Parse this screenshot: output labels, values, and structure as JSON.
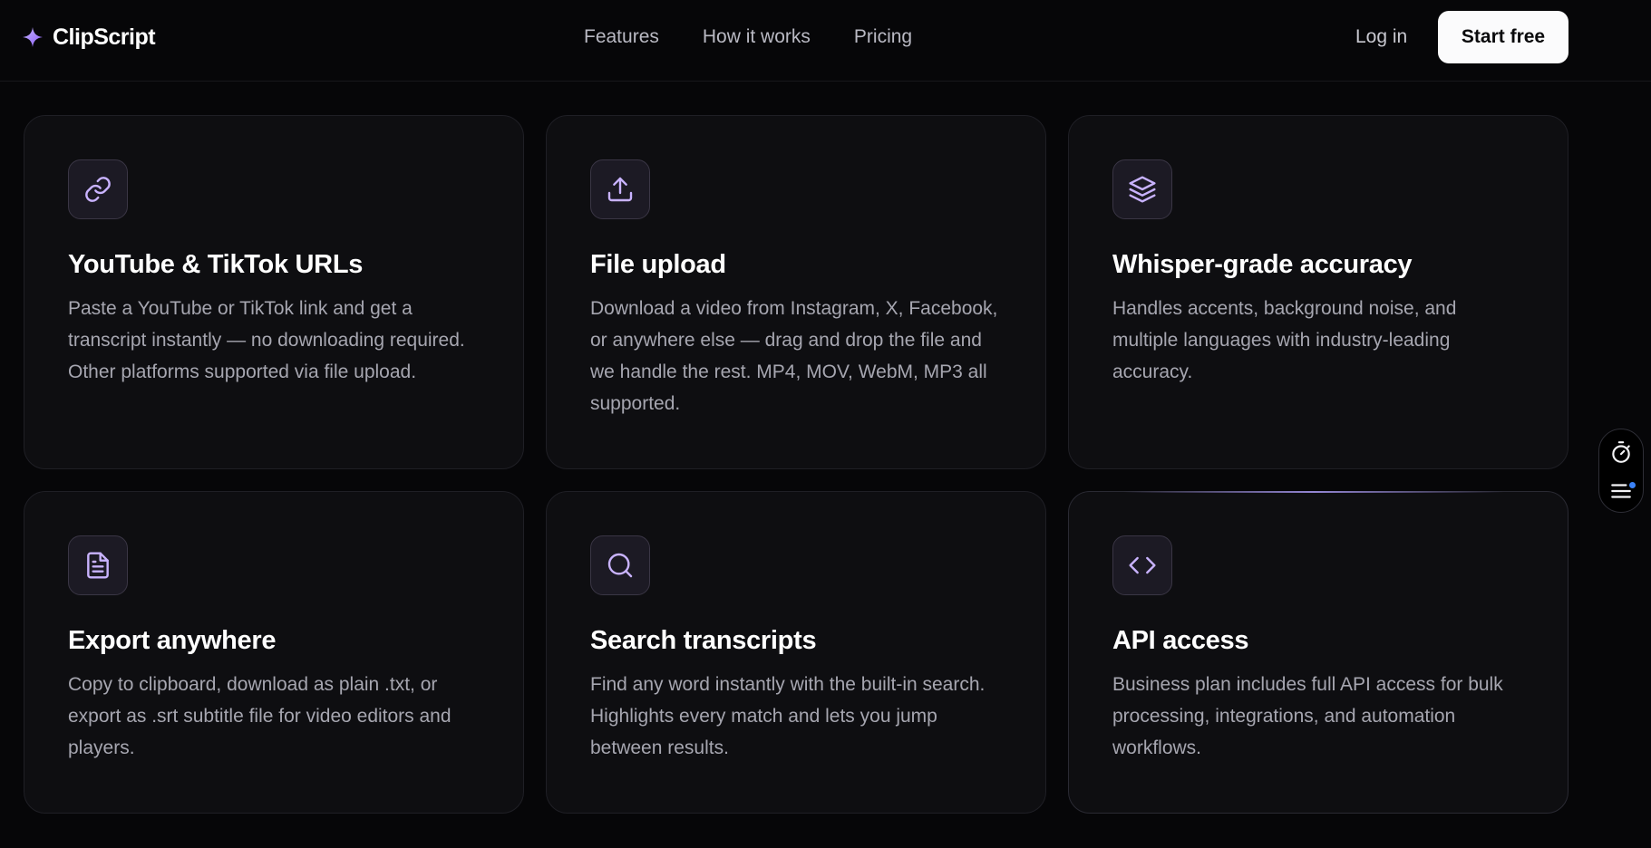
{
  "brand": {
    "name": "ClipScript",
    "icon": "sparkle-icon",
    "accent_color": "#a78bfa"
  },
  "nav": {
    "features": "Features",
    "how_it_works": "How it works",
    "pricing": "Pricing"
  },
  "auth": {
    "login": "Log in",
    "start": "Start free"
  },
  "features": [
    {
      "icon": "link-icon",
      "title": "YouTube & TikTok URLs",
      "description": "Paste a YouTube or TikTok link and get a transcript instantly — no downloading required. Other platforms supported via file upload."
    },
    {
      "icon": "upload-icon",
      "title": "File upload",
      "description": "Download a video from Instagram, X, Facebook, or anywhere else — drag and drop the file and we handle the rest. MP4, MOV, WebM, MP3 all supported."
    },
    {
      "icon": "layers-icon",
      "title": "Whisper-grade accuracy",
      "description": "Handles accents, background noise, and multiple languages with industry-leading accuracy."
    },
    {
      "icon": "document-icon",
      "title": "Export anywhere",
      "description": "Copy to clipboard, download as plain .txt, or export as .srt subtitle file for video editors and players."
    },
    {
      "icon": "search-icon",
      "title": "Search transcripts",
      "description": "Find any word instantly with the built-in search. Highlights every match and lets you jump between results."
    },
    {
      "icon": "code-icon",
      "title": "API access",
      "description": "Business plan includes full API access for bulk processing, integrations, and automation workflows."
    }
  ],
  "floating_panel": {
    "timer_icon": "stopwatch-icon",
    "menu_icon": "menu-icon",
    "badge_color": "#3b82f6"
  }
}
